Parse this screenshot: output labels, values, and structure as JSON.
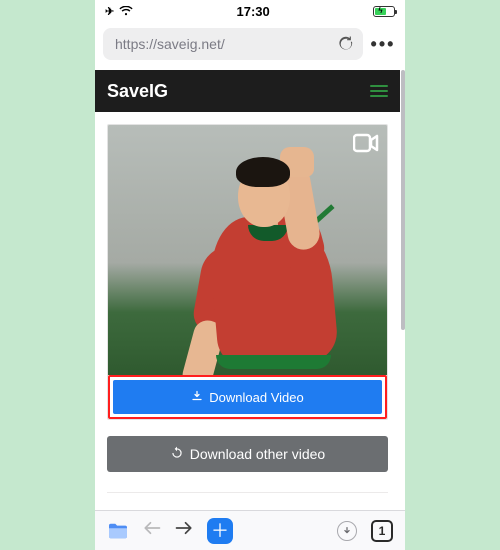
{
  "status": {
    "airplane_glyph": "✈",
    "time": "17:30"
  },
  "browser": {
    "url": "https://saveig.net/",
    "more_glyph": "•••"
  },
  "site": {
    "brand": "SaveIG"
  },
  "media": {
    "download_label": "Download Video",
    "other_label": "Download other video"
  },
  "bottom": {
    "tab_count": "1",
    "plus_glyph": "＋"
  },
  "colors": {
    "accent": "#1f7cf1",
    "secondary": "#6b6e71",
    "header": "#1d1d1d",
    "emph_border": "#ff1e1e",
    "bg": "#c5e8ce"
  }
}
